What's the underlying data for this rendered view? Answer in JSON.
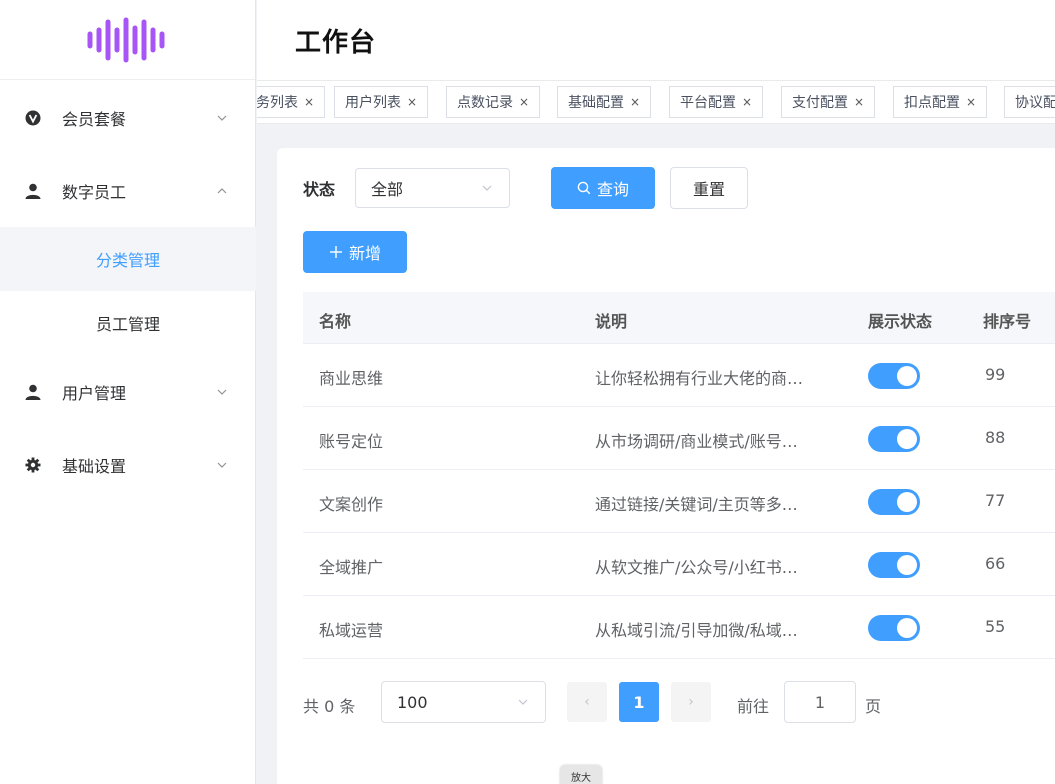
{
  "header": {
    "title": "工作台"
  },
  "sidebar": {
    "items": [
      {
        "label": "会员套餐",
        "icon": "v-circle-icon"
      },
      {
        "label": "数字员工",
        "icon": "user-icon"
      },
      {
        "label": "分类管理"
      },
      {
        "label": "员工管理"
      },
      {
        "label": "用户管理",
        "icon": "user-icon"
      },
      {
        "label": "基础设置",
        "icon": "gear-icon"
      }
    ]
  },
  "tabs": [
    {
      "label": "务列表"
    },
    {
      "label": "用户列表"
    },
    {
      "label": "点数记录"
    },
    {
      "label": "基础配置"
    },
    {
      "label": "平台配置"
    },
    {
      "label": "支付配置"
    },
    {
      "label": "扣点配置"
    },
    {
      "label": "协议配"
    }
  ],
  "tab_close": "×",
  "filter": {
    "label": "状态",
    "value": "全部",
    "query_label": "查询",
    "reset_label": "重置",
    "add_label": "新增"
  },
  "table": {
    "headers": [
      "名称",
      "说明",
      "展示状态",
      "排序号"
    ],
    "rows": [
      {
        "name": "商业思维",
        "desc": "让你轻松拥有行业大佬的商…",
        "shown": true,
        "order": "99"
      },
      {
        "name": "账号定位",
        "desc": "从市场调研/商业模式/账号…",
        "shown": true,
        "order": "88"
      },
      {
        "name": "文案创作",
        "desc": "通过链接/关键词/主页等多…",
        "shown": true,
        "order": "77"
      },
      {
        "name": "全域推广",
        "desc": "从软文推广/公众号/小红书…",
        "shown": true,
        "order": "66"
      },
      {
        "name": "私域运营",
        "desc": "从私域引流/引导加微/私域…",
        "shown": true,
        "order": "55"
      }
    ]
  },
  "pagination": {
    "total": "共 0 条",
    "page_size": "100",
    "prev": "‹",
    "current": "1",
    "next": "›",
    "goto_label": "前往",
    "goto_value": "1",
    "page_suffix": "页"
  },
  "tooltip": "放大",
  "colors": {
    "accent": "#409eff",
    "logo": "#a855f7",
    "active_bg": "#f3f5f9"
  }
}
